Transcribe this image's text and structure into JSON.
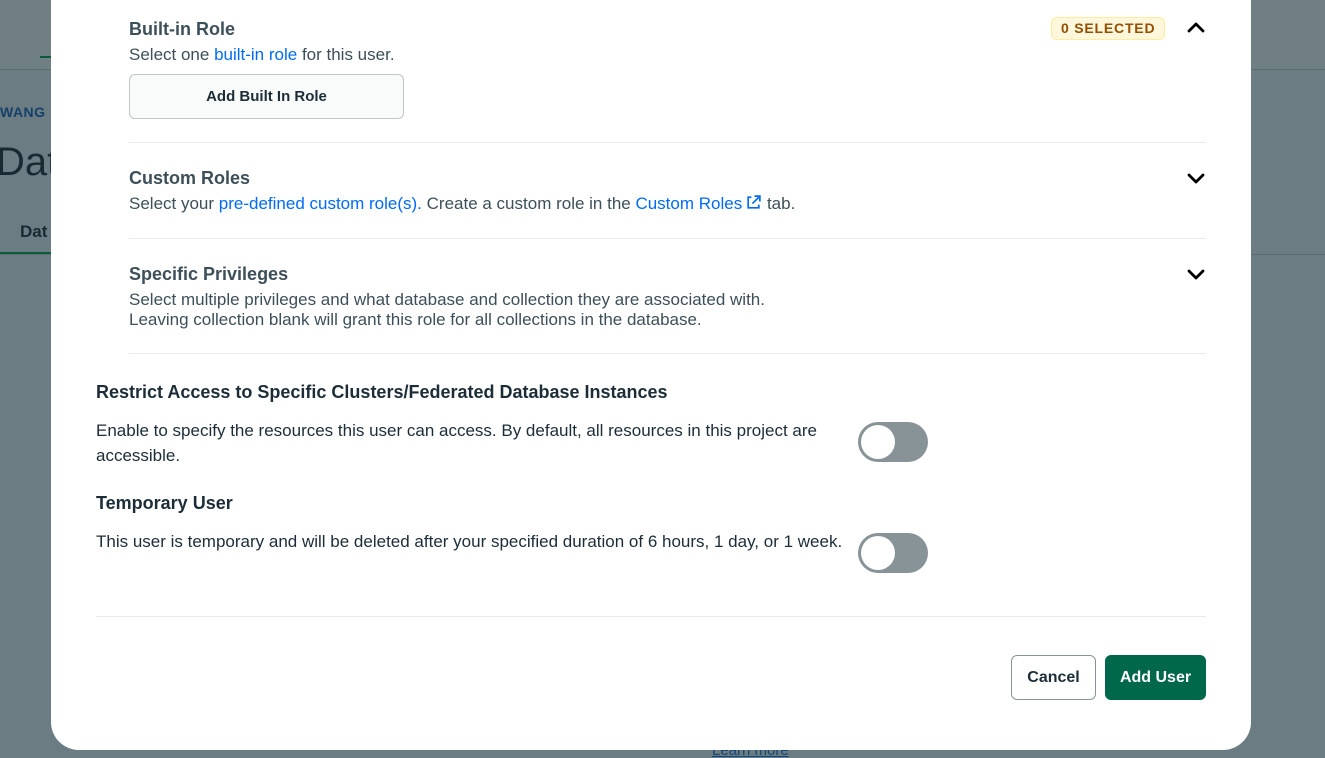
{
  "background": {
    "breadcrumb": "WANG",
    "title": "Dat",
    "tab": "Dat",
    "learn_more": "Learn more"
  },
  "built_in_role": {
    "title": "Built-in Role",
    "desc_prefix": "Select one ",
    "desc_link": "built-in role",
    "desc_suffix": " for this user.",
    "badge": "0 SELECTED",
    "add_button": "Add Built In Role",
    "chevron": "chevron-up-icon"
  },
  "custom_roles": {
    "title": "Custom Roles",
    "desc_prefix": "Select your ",
    "desc_link": "pre-defined custom role(s).",
    "desc_middle": " Create a custom role in the ",
    "desc_link2": "Custom Roles",
    "desc_suffix": " tab.",
    "chevron": "chevron-down-icon"
  },
  "specific_privileges": {
    "title": "Specific Privileges",
    "desc_line1": "Select multiple privileges and what database and collection they are associated with.",
    "desc_line2": "Leaving collection blank will grant this role for all collections in the database.",
    "chevron": "chevron-down-icon"
  },
  "restrict_access": {
    "title": "Restrict Access to Specific Clusters/Federated Database Instances",
    "desc": "Enable to specify the resources this user can access. By default, all resources in this project are accessible.",
    "enabled": false
  },
  "temporary_user": {
    "title": "Temporary User",
    "desc": "This user is temporary and will be deleted after your specified duration of 6 hours, 1 day, or 1 week.",
    "enabled": false
  },
  "footer": {
    "cancel_label": "Cancel",
    "add_user_label": "Add User"
  },
  "colors": {
    "link": "#016bf8",
    "primary": "#00684a",
    "badge_bg": "#fef7db",
    "badge_text": "#944f01"
  }
}
